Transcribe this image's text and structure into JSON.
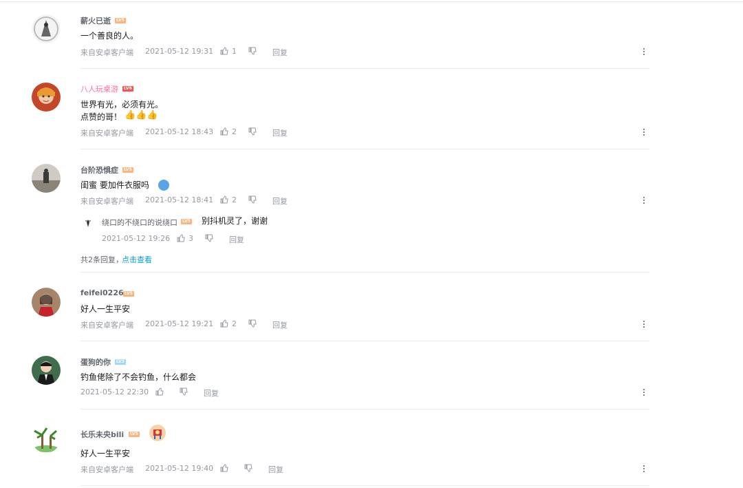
{
  "comments": [
    {
      "user": "薪火已逝",
      "level": "LV5",
      "text": "一个善良的人。",
      "source": "来自安卓客户端",
      "time": "2021-05-12 19:31",
      "likes": "1",
      "reply": "回复"
    },
    {
      "user": "八人玩桌游",
      "level": "LV6",
      "text1": "世界有光，必须有光。",
      "text2": "点赞的哥！",
      "emoji": "👍👍👍",
      "source": "来自安卓客户端",
      "time": "2021-05-12 18:43",
      "likes": "2",
      "reply": "回复"
    },
    {
      "user": "台阶恐惧症",
      "level": "LV5",
      "text": "闺蜜 要加件衣服吗",
      "source": "来自安卓客户端",
      "time": "2021-05-12 18:41",
      "likes": "2",
      "reply": "回复",
      "sub": {
        "user": "绕口的不绕口的说绕口",
        "level": "LV5",
        "text": "别抖机灵了，谢谢",
        "time": "2021-05-12 19:26",
        "likes": "3",
        "reply": "回复"
      },
      "summary": "共2条回复，",
      "view": "点击查看"
    },
    {
      "user": "feifei0226",
      "level": "LV5",
      "text": "好人一生平安",
      "source": "来自安卓客户端",
      "time": "2021-05-12 19:21",
      "likes": "2",
      "reply": "回复"
    },
    {
      "user": "蛋狗的你",
      "level": "LV3",
      "text": "钓鱼佬除了不会钓鱼，什么都会",
      "time": "2021-05-12 22:30",
      "reply": "回复"
    },
    {
      "user": "长乐未央bili",
      "level": "LV5",
      "text": "好人一生平安",
      "source": "来自安卓客户端",
      "time": "2021-05-12 19:40",
      "reply": "回复"
    }
  ],
  "colors": {
    "link": "#00a1d6",
    "vip_name": "#fb7299",
    "meta": "#9499a0"
  }
}
